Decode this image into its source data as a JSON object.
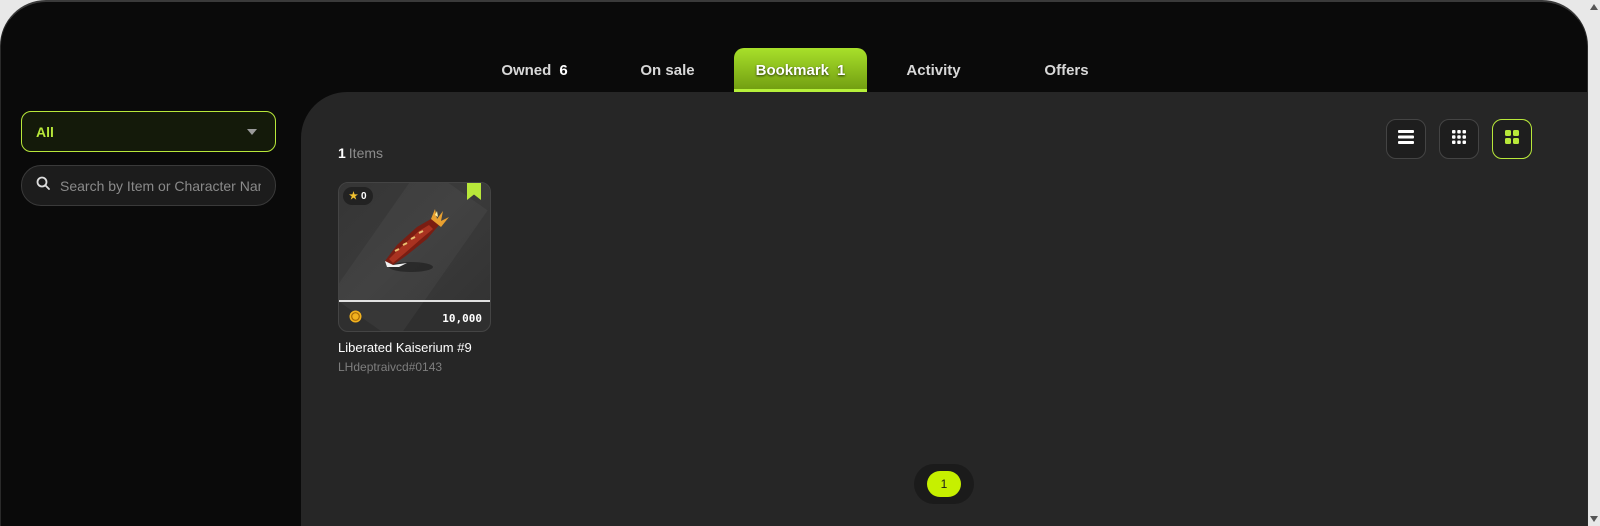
{
  "tabs": [
    {
      "label": "Owned",
      "count": "6"
    },
    {
      "label": "On sale",
      "count": ""
    },
    {
      "label": "Bookmark",
      "count": "1"
    },
    {
      "label": "Activity",
      "count": ""
    },
    {
      "label": "Offers",
      "count": ""
    }
  ],
  "active_tab": "Bookmark",
  "sidebar": {
    "filter_value": "All",
    "search_placeholder": "Search by Item or Character Name"
  },
  "main": {
    "items_count": "1",
    "items_label": "Items",
    "view_modes": [
      "list",
      "grid-small",
      "grid-large"
    ],
    "active_view": "grid-large"
  },
  "items": [
    {
      "name": "Liberated Kaiserium #9",
      "owner": "LHdeptraivcd#0143",
      "stars": "0",
      "price": "10,000",
      "bookmarked": true
    }
  ],
  "pagination": {
    "current": "1"
  },
  "colors": {
    "accent": "#c6f000",
    "background": "#0a0a0a",
    "panel": "#262626"
  }
}
